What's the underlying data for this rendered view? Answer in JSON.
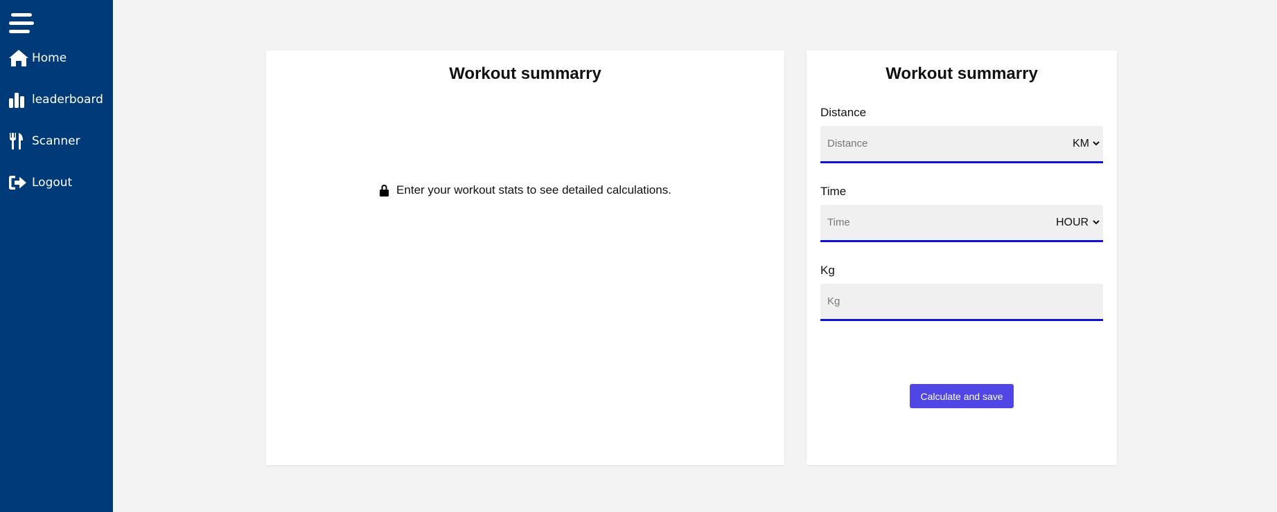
{
  "sidebar": {
    "items": [
      {
        "label": "Home",
        "icon": "home-icon"
      },
      {
        "label": "leaderboard",
        "icon": "bar-chart-icon"
      },
      {
        "label": "Scanner",
        "icon": "fork-knife-icon"
      },
      {
        "label": "Logout",
        "icon": "logout-icon"
      }
    ],
    "menu_icon": "hamburger-menu-icon",
    "background": "#003a79"
  },
  "summary_card": {
    "title": "Workout summarry",
    "empty_message": "Enter your workout stats to see detailed calculations.",
    "lock_icon": "lock-icon"
  },
  "form_card": {
    "title": "Workout summarry",
    "distance": {
      "label": "Distance",
      "placeholder": "Distance",
      "value": "",
      "unit": "KM"
    },
    "time": {
      "label": "Time",
      "placeholder": "Time",
      "value": "",
      "unit": "HOUR"
    },
    "kg": {
      "label": "Kg",
      "placeholder": "Kg",
      "value": ""
    },
    "submit_label": "Calculate and save"
  },
  "colors": {
    "accent": "#4f46e5",
    "field_underline": "#1010d8",
    "page_background": "#f3f3f3"
  }
}
